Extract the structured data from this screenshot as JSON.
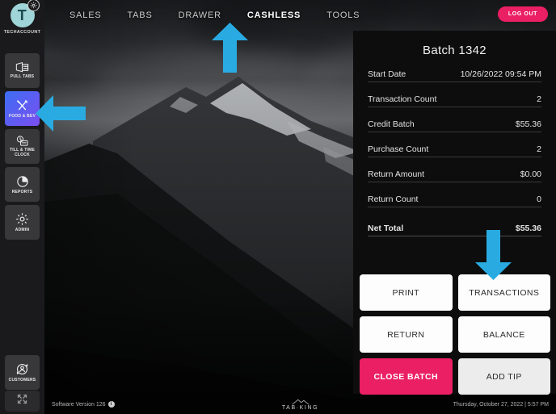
{
  "sidebar": {
    "account": {
      "initial": "T",
      "name": "TECHACCOUNT",
      "badge_icon": "gear-icon"
    },
    "items": [
      {
        "label": "PULL TABS",
        "icon": "pulltabs-icon",
        "active": false
      },
      {
        "label": "FOOD & BEV",
        "icon": "utensils-icon",
        "active": true
      },
      {
        "label": "TILL & TIME CLOCK",
        "icon": "till-clock-icon",
        "active": false
      },
      {
        "label": "REPORTS",
        "icon": "pie-chart-icon",
        "active": false
      },
      {
        "label": "ADMIN",
        "icon": "gear-icon",
        "active": false
      },
      {
        "label": "CUSTOMERS",
        "icon": "customers-icon",
        "active": false
      }
    ],
    "expand": {
      "icon": "expand-icon"
    }
  },
  "topnav": {
    "items": [
      {
        "label": "SALES",
        "active": false
      },
      {
        "label": "TABS",
        "active": false
      },
      {
        "label": "DRAWER",
        "active": false
      },
      {
        "label": "CASHLESS",
        "active": true
      },
      {
        "label": "TOOLS",
        "active": false
      }
    ],
    "logout_label": "LOG OUT",
    "accent_color": "#3577f0"
  },
  "panel": {
    "title": "Batch 1342",
    "rows": [
      {
        "label": "Start Date",
        "value": "10/26/2022 09:54 PM"
      },
      {
        "label": "Transaction Count",
        "value": "2"
      },
      {
        "label": "Credit Batch",
        "value": "$55.36"
      },
      {
        "label": "Purchase Count",
        "value": "2"
      },
      {
        "label": "Return Amount",
        "value": "$0.00"
      },
      {
        "label": "Return Count",
        "value": "0"
      }
    ],
    "net": {
      "label": "Net Total",
      "value": "$55.36"
    }
  },
  "actions": [
    {
      "label": "PRINT",
      "style": "white"
    },
    {
      "label": "TRANSACTIONS",
      "style": "white"
    },
    {
      "label": "RETURN",
      "style": "white"
    },
    {
      "label": "BALANCE",
      "style": "white"
    },
    {
      "label": "CLOSE BATCH",
      "style": "pink"
    },
    {
      "label": "ADD TIP",
      "style": "grey"
    }
  ],
  "footer": {
    "version": "Software Version 126",
    "info_icon": "info-icon",
    "brand": "TAB·KING",
    "datetime": "Thursday, October 27, 2022  |  5:57 PM"
  },
  "annotations": {
    "color": "#29ABE2",
    "arrows": [
      {
        "name": "arrow-pointing-to-cashless-tab",
        "direction": "up"
      },
      {
        "name": "arrow-pointing-to-food-bev-nav",
        "direction": "left"
      },
      {
        "name": "arrow-pointing-to-transactions-button",
        "direction": "down"
      }
    ]
  }
}
